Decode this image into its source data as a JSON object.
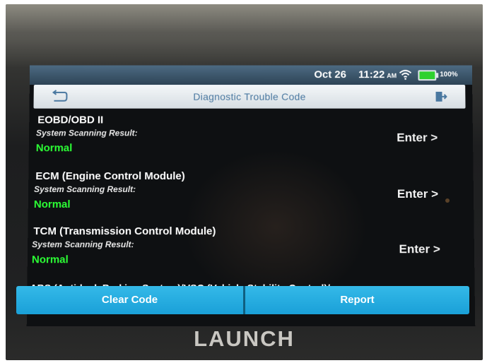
{
  "status_bar": {
    "date": "Oct 26",
    "time": "11:22",
    "ampm": "AM",
    "battery": "100%",
    "battery_color": "#2fd12f"
  },
  "header": {
    "title": "Diagnostic Trouble Code",
    "back_icon": "back-icon",
    "exit_icon": "exit-icon"
  },
  "modules": [
    {
      "name": "EOBD/OBD II",
      "subtitle": "System Scanning Result:",
      "result": "Normal",
      "enter": "Enter >"
    },
    {
      "name": "ECM (Engine Control Module)",
      "subtitle": "System Scanning Result:",
      "result": "Normal",
      "enter": "Enter >"
    },
    {
      "name": "TCM (Transmission Control Module)",
      "subtitle": "System Scanning Result:",
      "result": "Normal",
      "enter": "Enter >"
    }
  ],
  "partial_module": "ABS (Anti-lock Braking System)/VSC (Vehicle Stability Control)/",
  "buttons": {
    "clear_code": "Clear Code",
    "report": "Report",
    "accent": "#1aa0d8"
  },
  "brand": "LAUNCH",
  "result_color": "#2cff35"
}
